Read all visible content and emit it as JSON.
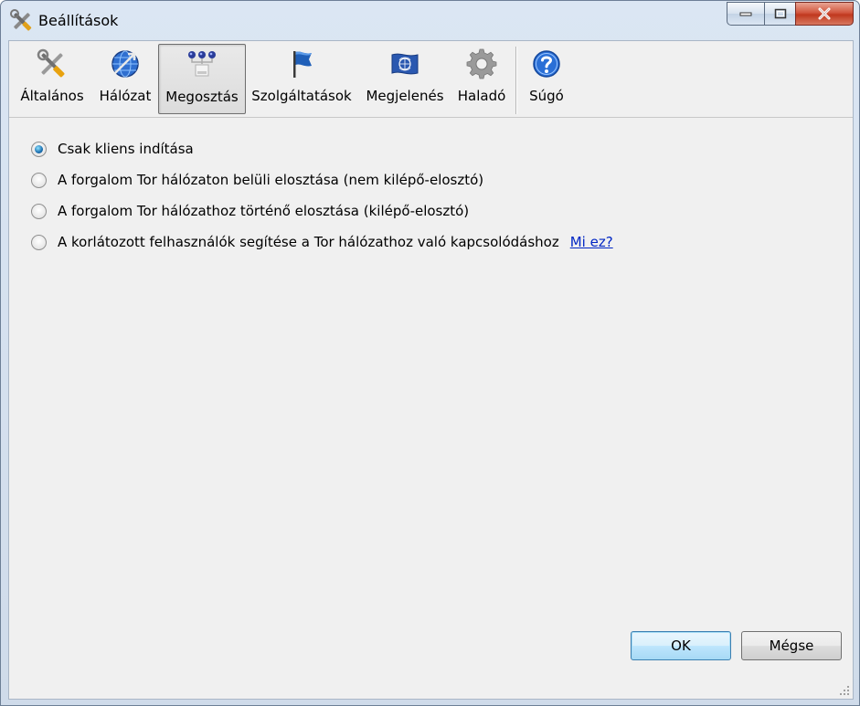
{
  "window": {
    "title": "Beállítások"
  },
  "toolbar": {
    "items": [
      {
        "label": "Általános",
        "icon": "tools-icon"
      },
      {
        "label": "Hálózat",
        "icon": "network-globe-icon"
      },
      {
        "label": "Megosztás",
        "icon": "sharing-icon"
      },
      {
        "label": "Szolgáltatások",
        "icon": "flag-icon"
      },
      {
        "label": "Megjelenés",
        "icon": "appearance-flag-icon"
      },
      {
        "label": "Haladó",
        "icon": "gear-icon"
      },
      {
        "label": "Súgó",
        "icon": "help-icon"
      }
    ],
    "active": "Megosztás"
  },
  "options": [
    {
      "label": "Csak kliens indítása",
      "checked": true
    },
    {
      "label": "A forgalom Tor hálózaton belüli elosztása (nem kilépő-elosztó)",
      "checked": false
    },
    {
      "label": "A forgalom Tor hálózathoz történő elosztása (kilépő-elosztó)",
      "checked": false
    },
    {
      "label": "A korlátozott felhasználók segítése a Tor hálózathoz való kapcsolódáshoz",
      "checked": false,
      "link": "Mi ez?"
    }
  ],
  "buttons": {
    "ok": "OK",
    "cancel": "Mégse"
  },
  "colors": {
    "link": "#0026c4",
    "close_button": "#c0381e",
    "dialog_bg": "#f0f0f0"
  }
}
